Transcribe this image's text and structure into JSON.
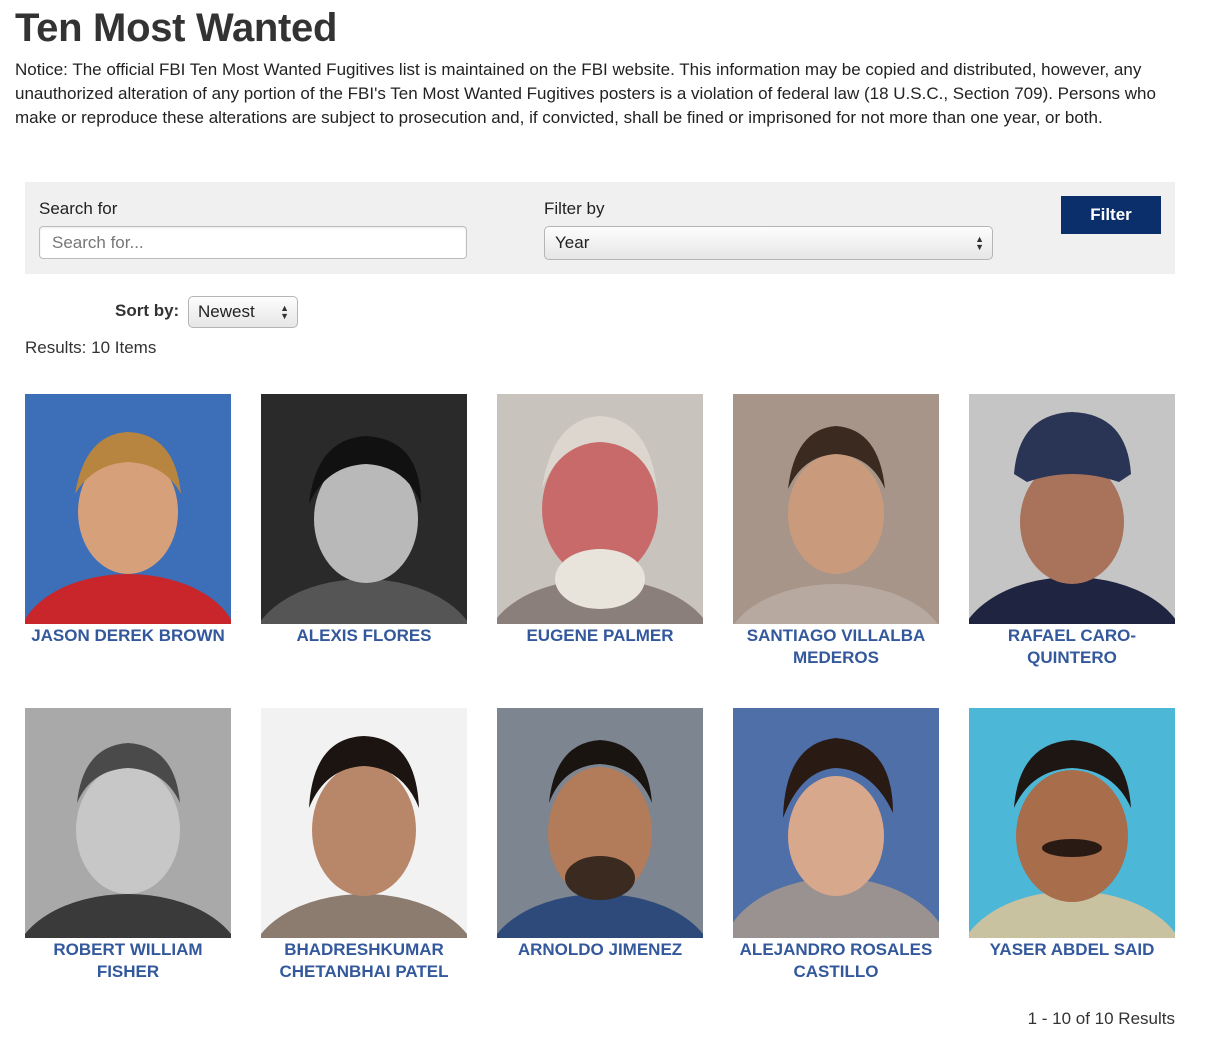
{
  "title": "Ten Most Wanted",
  "notice": "Notice: The official FBI Ten Most Wanted Fugitives list is maintained on the FBI website. This information may be copied and distributed, however, any unauthorized alteration of any portion of the FBI's Ten Most Wanted Fugitives posters is a violation of federal law (18 U.S.C., Section 709). Persons who make or reproduce these alterations are subject to prosecution and, if convicted, shall be fined or imprisoned for not more than one year, or both.",
  "filter_panel": {
    "search_label": "Search for",
    "search_placeholder": "Search for...",
    "search_value": "",
    "filter_label": "Filter by",
    "filter_selected": "Year",
    "filter_button": "Filter"
  },
  "sort": {
    "label": "Sort by:",
    "selected": "Newest"
  },
  "results_label": "Results: 10 Items",
  "fugitives": [
    {
      "name": "JASON DEREK BROWN",
      "photo": "color-portrait"
    },
    {
      "name": "ALEXIS FLORES",
      "photo": "bw-portrait"
    },
    {
      "name": "EUGENE PALMER",
      "photo": "color-portrait"
    },
    {
      "name": "SANTIAGO VILLALBA MEDEROS",
      "photo": "color-portrait"
    },
    {
      "name": "RAFAEL CARO-QUINTERO",
      "photo": "color-portrait"
    },
    {
      "name": "ROBERT WILLIAM FISHER",
      "photo": "bw-portrait"
    },
    {
      "name": "BHADRESHKUMAR CHETANBHAI PATEL",
      "photo": "color-portrait"
    },
    {
      "name": "ARNOLDO JIMENEZ",
      "photo": "color-portrait"
    },
    {
      "name": "ALEJANDRO ROSALES CASTILLO",
      "photo": "color-portrait"
    },
    {
      "name": "YASER ABDEL SAID",
      "photo": "color-portrait"
    }
  ],
  "pagination": "1 - 10 of 10 Results",
  "colors": {
    "name_link": "#33589c",
    "filter_button": "#0b2f6b",
    "panel": "#f0f0f0"
  }
}
